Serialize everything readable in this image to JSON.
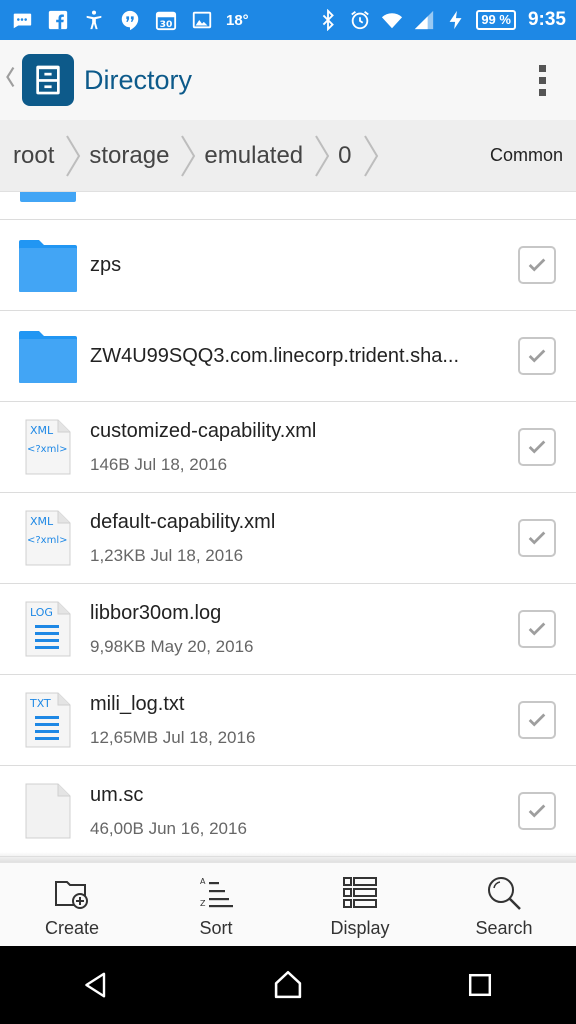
{
  "status_bar": {
    "temperature": "18°",
    "battery": "99 %",
    "time": "9:35",
    "icons": [
      "messages-icon",
      "facebook-icon",
      "accessibility-icon",
      "hangouts-icon",
      "calendar-icon",
      "gallery-icon",
      "bluetooth-icon",
      "alarm-icon",
      "wifi-icon",
      "signal-icon",
      "charging-icon"
    ]
  },
  "app_bar": {
    "title": "Directory",
    "back_icon": "chevron-left-icon",
    "logo_icon": "file-cabinet-icon",
    "menu_icon": "overflow-menu-icon"
  },
  "breadcrumb": {
    "items": [
      "root",
      "storage",
      "emulated",
      "0"
    ],
    "common_label": "Common"
  },
  "colors": {
    "status_bar": "#1E88E5",
    "brand": "#0D5A8A",
    "folder": "#42A5F5",
    "file_accent": "#1E88E5"
  },
  "files": [
    {
      "name": "zps",
      "meta": "",
      "type": "folder"
    },
    {
      "name": "ZW4U99SQQ3.com.linecorp.trident.sha...",
      "meta": "",
      "type": "folder"
    },
    {
      "name": "customized-capability.xml",
      "meta": "146B Jul 18, 2016",
      "type": "xml",
      "tag": "XML",
      "tag2": "<?xml>"
    },
    {
      "name": "default-capability.xml",
      "meta": "1,23KB Jul 18, 2016",
      "type": "xml",
      "tag": "XML",
      "tag2": "<?xml>"
    },
    {
      "name": "libbor30om.log",
      "meta": "9,98KB May 20, 2016",
      "type": "log",
      "tag": "LOG"
    },
    {
      "name": "mili_log.txt",
      "meta": "12,65MB Jul 18, 2016",
      "type": "txt",
      "tag": "TXT"
    },
    {
      "name": "um.sc",
      "meta": "46,00B Jun 16, 2016",
      "type": "generic"
    }
  ],
  "toolbar": {
    "create_label": "Create",
    "sort_label": "Sort",
    "display_label": "Display",
    "search_label": "Search"
  },
  "nav_bar": {
    "back_icon": "nav-back-icon",
    "home_icon": "nav-home-icon",
    "recents_icon": "nav-recents-icon"
  }
}
